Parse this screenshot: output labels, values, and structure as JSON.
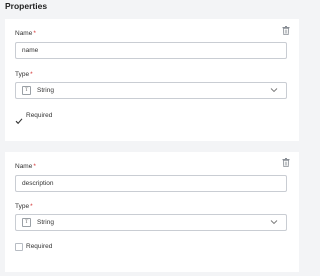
{
  "section_title": "Properties",
  "properties": [
    {
      "name_label": "Name",
      "required_marker": "*",
      "name_value": "name",
      "type_label": "Type",
      "type_value": "String",
      "type_icon": "T",
      "required_label": "Required",
      "required_checked": true
    },
    {
      "name_label": "Name",
      "required_marker": "*",
      "name_value": "description",
      "type_label": "Type",
      "type_value": "String",
      "type_icon": "T",
      "required_label": "Required",
      "required_checked": false
    }
  ],
  "icons": {
    "delete": "trash-icon",
    "dropdown": "chevron-down-icon",
    "type": "text-type-icon",
    "check": "checkmark-icon"
  }
}
